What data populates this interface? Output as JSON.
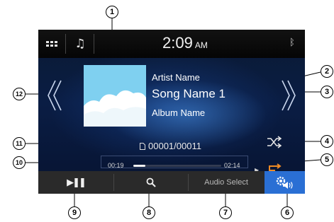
{
  "status_bar": {
    "clock": "2:09",
    "ampm": "AM",
    "icons": [
      "grid-menu-icon",
      "music-note-icon",
      "bluetooth-icon"
    ]
  },
  "track": {
    "artwork_text": "Artist Name",
    "artist": "Artist Name",
    "song": "Song Name 1",
    "album": "Album Name",
    "counter": "00001/00011"
  },
  "progress": {
    "elapsed": "00:19",
    "total": "02:14",
    "fraction": 0.14
  },
  "bottom_bar": {
    "play_pause": "▶❚❚",
    "audio_select": "Audio Select"
  },
  "callouts": [
    "1",
    "2",
    "3",
    "4",
    "5",
    "6",
    "7",
    "8",
    "9",
    "10",
    "11",
    "12"
  ],
  "colors": {
    "settings_accent": "#2a6fd4",
    "repeat_accent": "#f08a24",
    "background": "#0a1d44"
  }
}
